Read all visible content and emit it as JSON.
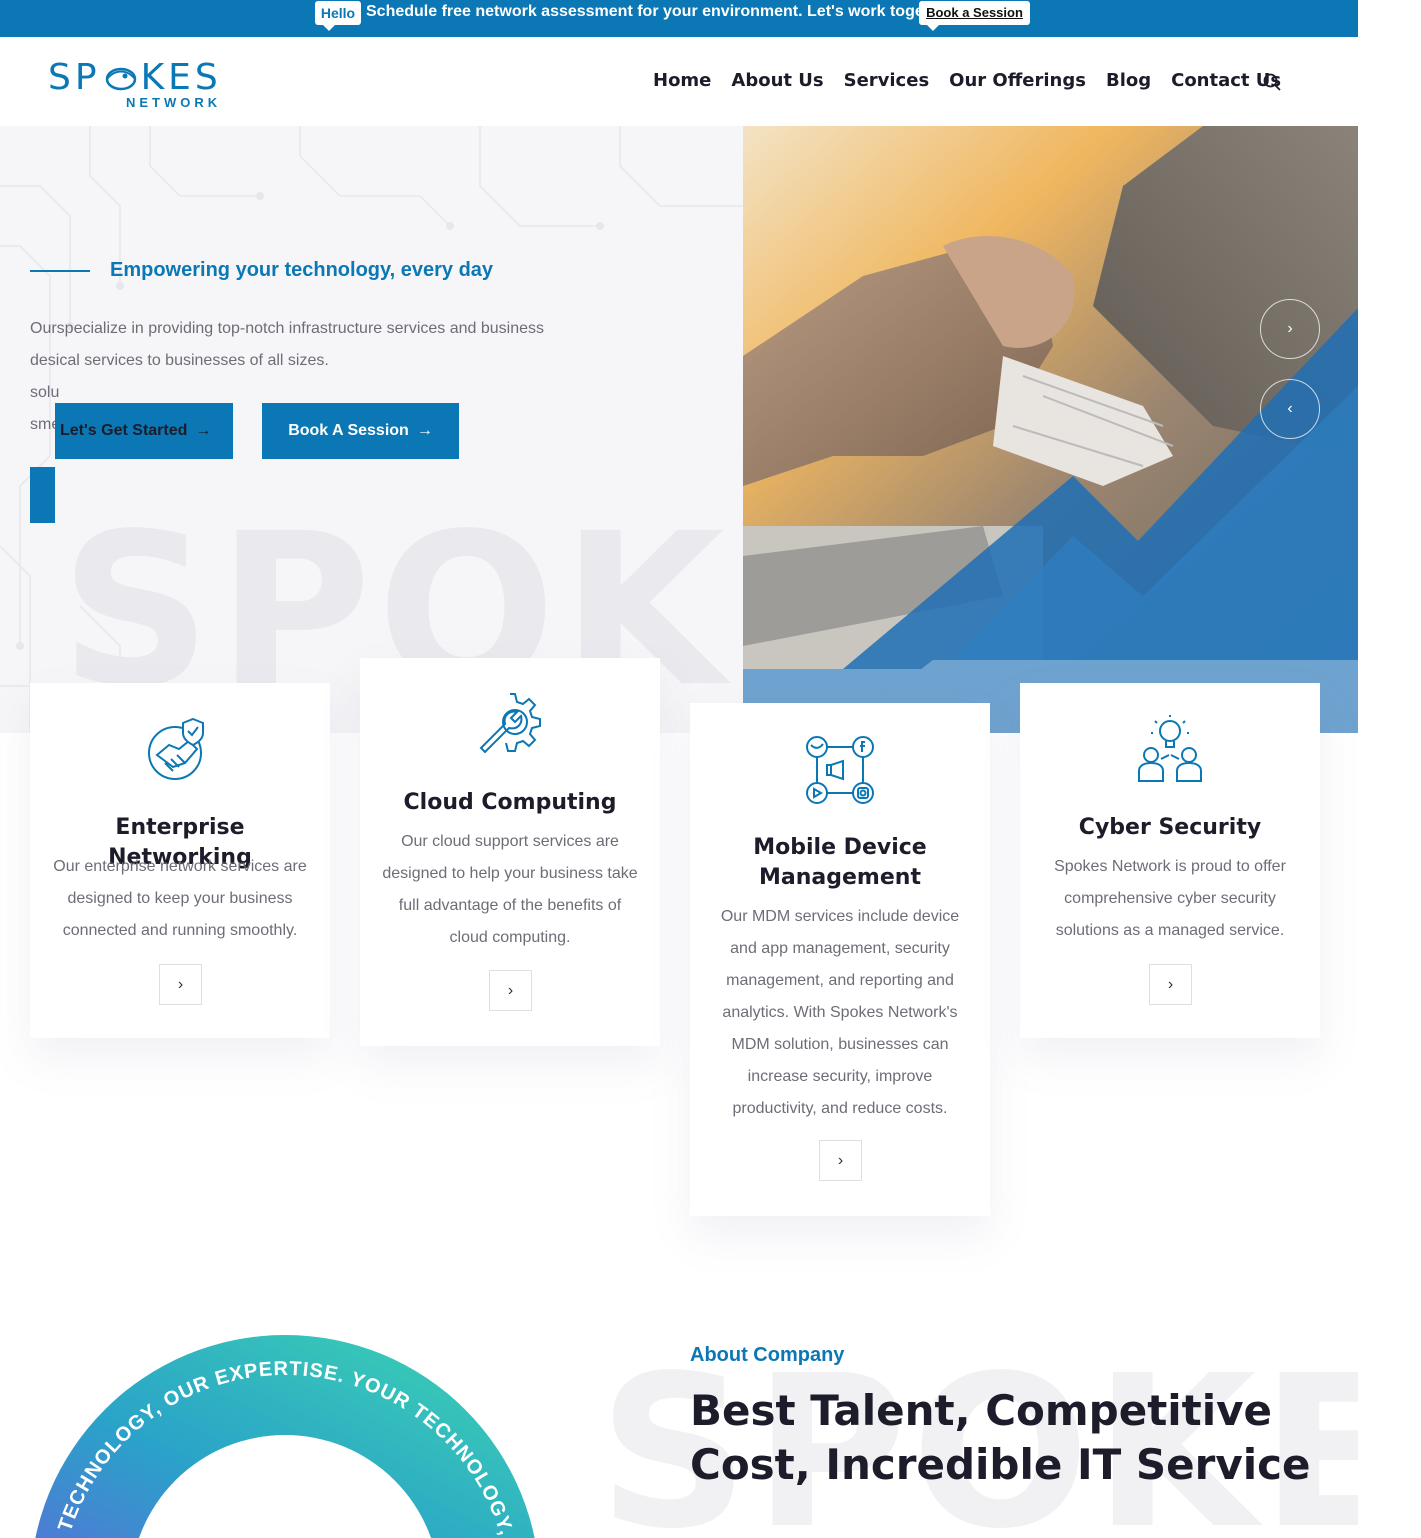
{
  "topbar": {
    "badge": "Hello",
    "message": "Schedule free network assessment for your environment. Let's work together",
    "cta": "Book a Session"
  },
  "brand": {
    "logo_text_left": "SP",
    "logo_text_right": "KES",
    "logo_sub": "NETWORK"
  },
  "nav": {
    "items": [
      "Home",
      "About Us",
      "Services",
      "Our Offerings",
      "Blog",
      "Contact Us"
    ],
    "search_icon": "search-icon"
  },
  "hero": {
    "subtitle": "Empowering your technology, every day",
    "para_line1": "Ourspecialize in providing top-notch infrastructure services and business",
    "para_line2": "desical services to businesses of all sizes.",
    "para_line3": "solu",
    "para_line4": "sme",
    "btn_primary": "Let's Get Started",
    "btn_secondary": "Book A Session",
    "bg_word": "SPOKE",
    "next_icon": "chevron-right-icon",
    "prev_icon": "chevron-left-icon"
  },
  "services": [
    {
      "title": "Enterprise Networking",
      "text": "Our enterprise network services are designed to keep your business connected and running smoothly.",
      "icon": "handshake-shield-icon"
    },
    {
      "title": "Cloud Computing",
      "text": "Our cloud support services are designed to help your business take full advantage of the benefits of cloud computing.",
      "icon": "gear-wrench-icon"
    },
    {
      "title": "Mobile Device Management",
      "text": "Our MDM services include device and app management, security management, and reporting and analytics. With Spokes Network's MDM solution, businesses can increase security, improve productivity, and reduce costs.",
      "icon": "social-media-icon"
    },
    {
      "title": "Cyber Security",
      "text": "Spokes Network is proud to offer comprehensive cyber security solutions as a managed service.",
      "icon": "team-idea-icon"
    }
  ],
  "about": {
    "label": "About Company",
    "title": "Best Talent, Competitive Cost, Incredible IT Service",
    "bg_word": "SPOKES",
    "ring_text": "YOUR TECHNOLOGY, OUR EXPERTISE.   YOUR TECHNOLOGY, OUR EXPERTISE.   "
  },
  "colors": {
    "brand_blue": "#0b78b5",
    "light_blue": "#6fa3cf",
    "hero_bg": "#f6f6f8"
  }
}
